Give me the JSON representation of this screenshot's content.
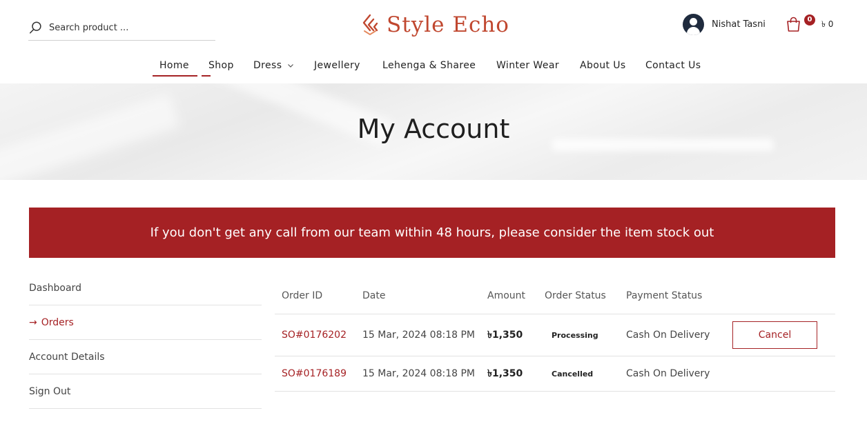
{
  "header": {
    "search": {
      "placeholder": "Search product ..."
    },
    "logo": {
      "text": "Style Echo"
    },
    "user": {
      "name": "Nishat Tasni"
    },
    "cart": {
      "count": "0",
      "total": "৳ 0"
    },
    "colors": {
      "brand": "#a52124",
      "logo": "#c0472f"
    }
  },
  "nav": {
    "items": [
      {
        "label": "Home"
      },
      {
        "label": "Shop"
      },
      {
        "label": "Dress"
      },
      {
        "label": "Jewellery"
      },
      {
        "label": "Lehenga & Sharee"
      },
      {
        "label": "Winter Wear"
      },
      {
        "label": "About Us"
      },
      {
        "label": "Contact Us"
      }
    ]
  },
  "banner": {
    "title": "My Account"
  },
  "notice": {
    "text": "If you don't get any call from our team within 48 hours, please consider the item stock out"
  },
  "sidebar": {
    "items": [
      {
        "label": "Dashboard"
      },
      {
        "label": "Orders",
        "arrow": "→"
      },
      {
        "label": "Account Details"
      },
      {
        "label": "Sign Out"
      }
    ]
  },
  "orders": {
    "headers": [
      "Order ID",
      "Date",
      "Amount",
      "Order Status",
      "Payment Status"
    ],
    "rows": [
      {
        "id": "SO#0176202",
        "date": "15 Mar, 2024 08:18 PM",
        "amount": "৳1,350",
        "status": "Processing",
        "payment": "Cash On Delivery",
        "action": "Cancel"
      },
      {
        "id": "SO#0176189",
        "date": "15 Mar, 2024 08:18 PM",
        "amount": "৳1,350",
        "status": "Cancelled",
        "payment": "Cash On Delivery"
      }
    ]
  }
}
